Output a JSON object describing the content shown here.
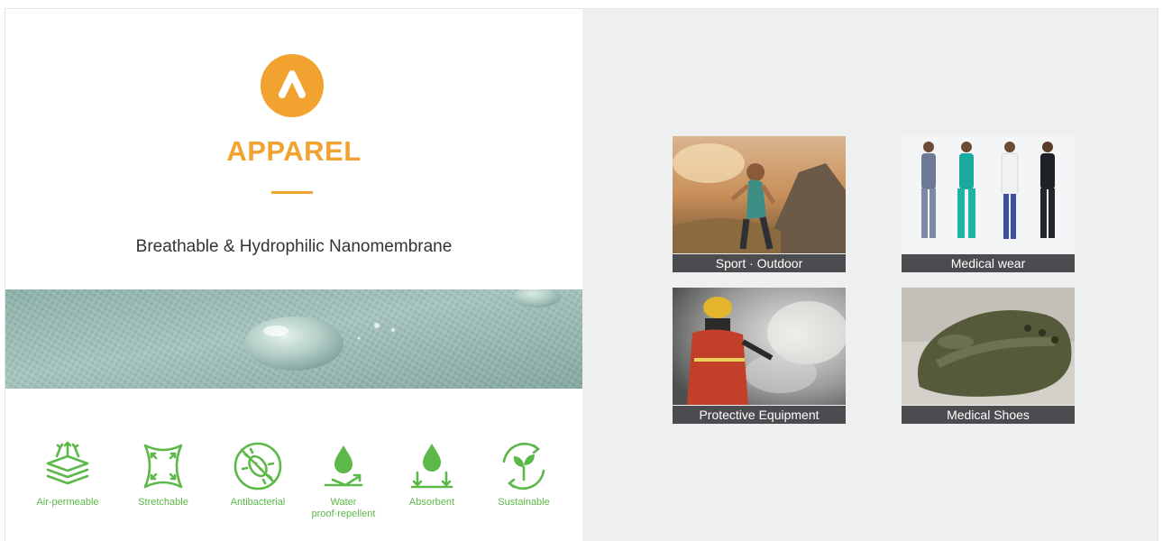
{
  "brand": {
    "title": "APPAREL",
    "subtitle": "Breathable & Hydrophilic Nanomembrane",
    "accent_color": "#f2a22f",
    "icon": "arrow-up-logo-icon"
  },
  "features": {
    "color": "#5cb848",
    "items": [
      {
        "label": "Air-permeable",
        "icon": "air-permeable-icon"
      },
      {
        "label": "Stretchable",
        "icon": "stretchable-icon"
      },
      {
        "label": "Antibacterial",
        "icon": "antibacterial-icon"
      },
      {
        "label_line1": "Water",
        "label_line2": "proof·repellent",
        "icon": "water-repellent-icon"
      },
      {
        "label": "Absorbent",
        "icon": "absorbent-icon"
      },
      {
        "label": "Sustainable",
        "icon": "sustainable-icon"
      }
    ]
  },
  "applications": [
    {
      "label": "Sport · Outdoor"
    },
    {
      "label": "Medical wear"
    },
    {
      "label": "Protective Equipment"
    },
    {
      "label": "Medical Shoes"
    }
  ]
}
